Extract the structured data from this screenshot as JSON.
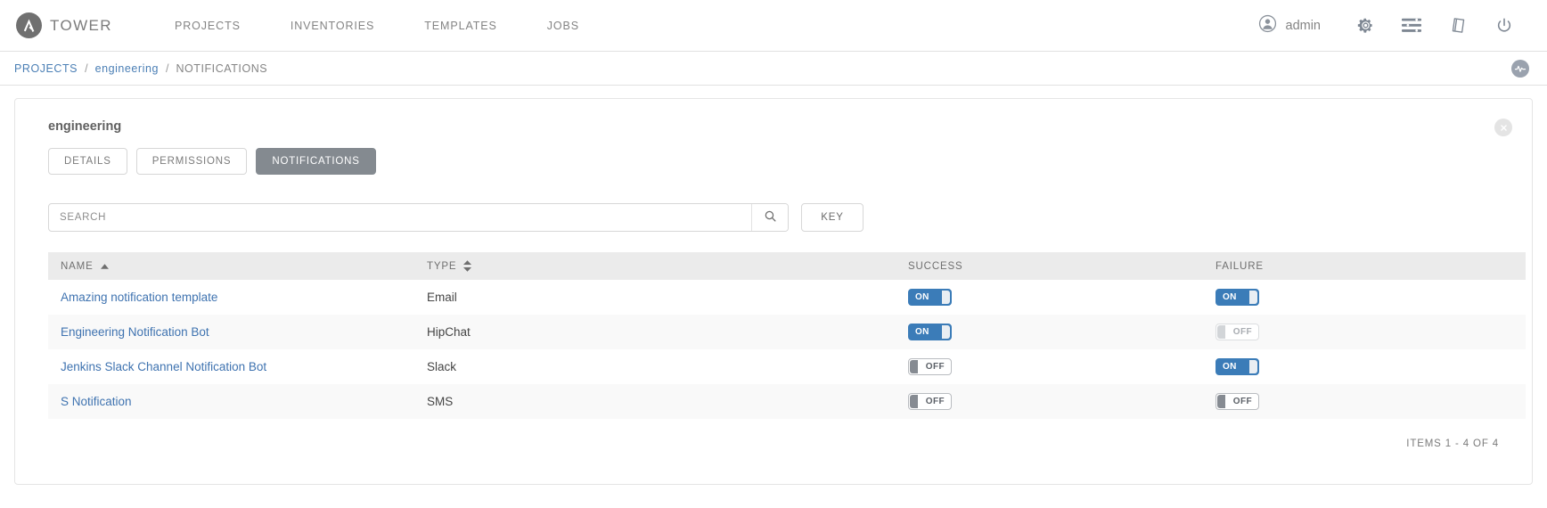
{
  "topnav": {
    "brand": "TOWER",
    "links": [
      {
        "label": "PROJECTS"
      },
      {
        "label": "INVENTORIES"
      },
      {
        "label": "TEMPLATES"
      },
      {
        "label": "JOBS"
      }
    ],
    "user": "admin",
    "icons": [
      {
        "name": "user-circle-icon"
      },
      {
        "name": "gear-icon"
      },
      {
        "name": "sliders-icon"
      },
      {
        "name": "book-icon"
      },
      {
        "name": "power-icon"
      }
    ]
  },
  "breadcrumb": {
    "items": [
      {
        "label": "PROJECTS",
        "current": false
      },
      {
        "label": "engineering",
        "current": false
      },
      {
        "label": "NOTIFICATIONS",
        "current": true
      }
    ],
    "separator": "/",
    "activity_icon": "activity-pulse-icon"
  },
  "card": {
    "title": "engineering",
    "close_icon": "close-icon",
    "tabs": [
      {
        "label": "DETAILS",
        "active": false
      },
      {
        "label": "PERMISSIONS",
        "active": false
      },
      {
        "label": "NOTIFICATIONS",
        "active": true
      }
    ]
  },
  "search": {
    "placeholder": "SEARCH",
    "value": "",
    "search_icon": "search-icon",
    "key_label": "KEY"
  },
  "table": {
    "columns": [
      {
        "label": "NAME",
        "sort": "asc"
      },
      {
        "label": "TYPE",
        "sort": "none"
      },
      {
        "label": "SUCCESS",
        "sort": null
      },
      {
        "label": "FAILURE",
        "sort": null
      }
    ],
    "rows": [
      {
        "name": "Amazing notification template",
        "type": "Email",
        "success": {
          "state": "ON",
          "on": true,
          "muted": false
        },
        "failure": {
          "state": "ON",
          "on": true,
          "muted": false
        }
      },
      {
        "name": "Engineering Notification Bot",
        "type": "HipChat",
        "success": {
          "state": "ON",
          "on": true,
          "muted": false
        },
        "failure": {
          "state": "OFF",
          "on": false,
          "muted": true
        }
      },
      {
        "name": "Jenkins Slack Channel Notification Bot",
        "type": "Slack",
        "success": {
          "state": "OFF",
          "on": false,
          "muted": false
        },
        "failure": {
          "state": "ON",
          "on": true,
          "muted": false
        }
      },
      {
        "name": "S Notification",
        "type": "SMS",
        "success": {
          "state": "OFF",
          "on": false,
          "muted": false
        },
        "failure": {
          "state": "OFF",
          "on": false,
          "muted": false
        }
      }
    ],
    "items_count": "ITEMS  1 - 4 OF 4"
  },
  "colors": {
    "link": "#3f73b0",
    "toggle_on": "#3b7cb8",
    "tab_active_bg": "#848a90",
    "header_row_bg": "#ebebeb"
  }
}
